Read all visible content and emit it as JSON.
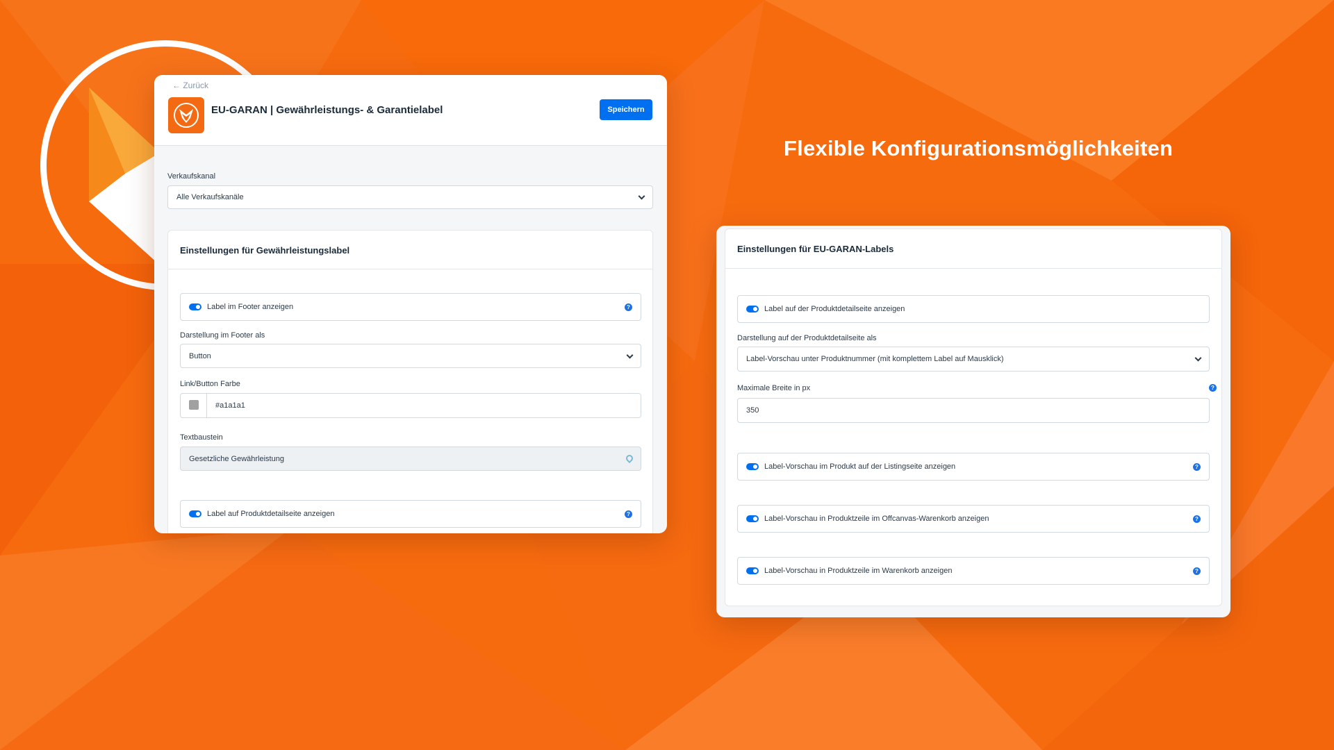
{
  "headline": "Flexible Konfigurationsmöglichkeiten",
  "colors": {
    "accent": "#0070f0",
    "brand": "#f46a12",
    "background": "#f76b0f"
  },
  "left_panel": {
    "back_label": "← Zurück",
    "app_title": "EU-GARAN | Gewährleistungs- & Garantielabel",
    "save_label": "Speichern",
    "sales_channel": {
      "label": "Verkaufskanal",
      "value": "Alle Verkaufskanäle"
    },
    "section": {
      "title": "Einstellungen für Gewährleistungslabel",
      "footer_toggle": "Label im Footer anzeigen",
      "footer_display": {
        "label": "Darstellung im Footer als",
        "value": "Button"
      },
      "link_color": {
        "label": "Link/Button Farbe",
        "value": "#a1a1a1"
      },
      "text_snippet": {
        "label": "Textbaustein",
        "value": "Gesetzliche Gewährleistung"
      },
      "detail_toggle": "Label auf Produktdetailseite anzeigen"
    }
  },
  "right_panel": {
    "section_title": "Einstellungen für EU-GARAN-Labels",
    "detail_toggle": "Label auf der Produktdetailseite anzeigen",
    "detail_display": {
      "label": "Darstellung auf der Produktdetailseite als",
      "value": "Label-Vorschau unter Produktnummer (mit komplettem Label auf Mausklick)"
    },
    "max_width": {
      "label": "Maximale Breite in px",
      "value": "350"
    },
    "listing_toggle": "Label-Vorschau im Produkt auf der Listingseite anzeigen",
    "offcanvas_toggle": "Label-Vorschau in Produktzeile im Offcanvas-Warenkorb anzeigen",
    "cart_toggle": "Label-Vorschau in Produktzeile im Warenkorb anzeigen"
  }
}
